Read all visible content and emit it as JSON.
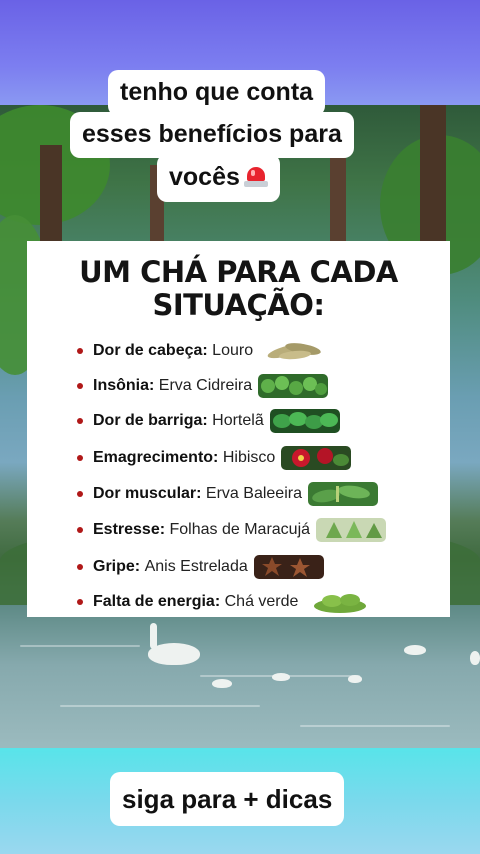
{
  "caption_top": {
    "line1": "tenho que conta",
    "line2": "esses benefícios para",
    "line3": "vocês",
    "emoji": "police-light-icon"
  },
  "card": {
    "title_line1": "UM CHÁ PARA CADA",
    "title_line2": "SITUAÇÃO:",
    "items": [
      {
        "label": "Dor de cabeça",
        "value": "Louro",
        "icon": "bay-leaf-icon"
      },
      {
        "label": "Insônia",
        "value": "Erva Cidreira",
        "icon": "lemon-balm-icon"
      },
      {
        "label": "Dor de barriga",
        "value": "Hortelã",
        "icon": "mint-icon"
      },
      {
        "label": "Emagrecimento",
        "value": "Hibisco",
        "icon": "hibiscus-icon"
      },
      {
        "label": "Dor muscular",
        "value": "Erva Baleeira",
        "icon": "erva-baleeira-icon"
      },
      {
        "label": "Estresse",
        "value": "Folhas de Maracujá",
        "icon": "passion-fruit-leaf-icon"
      },
      {
        "label": "Gripe",
        "value": "Anis Estrelada",
        "icon": "star-anise-icon"
      },
      {
        "label": "Falta de energia",
        "value": "Chá verde",
        "icon": "green-tea-icon"
      }
    ]
  },
  "caption_bottom": {
    "text": "siga para + dicas"
  },
  "colors": {
    "bullet": "#b01818",
    "top_background": "#6a62e6",
    "bottom_background": "#58e4ea"
  }
}
